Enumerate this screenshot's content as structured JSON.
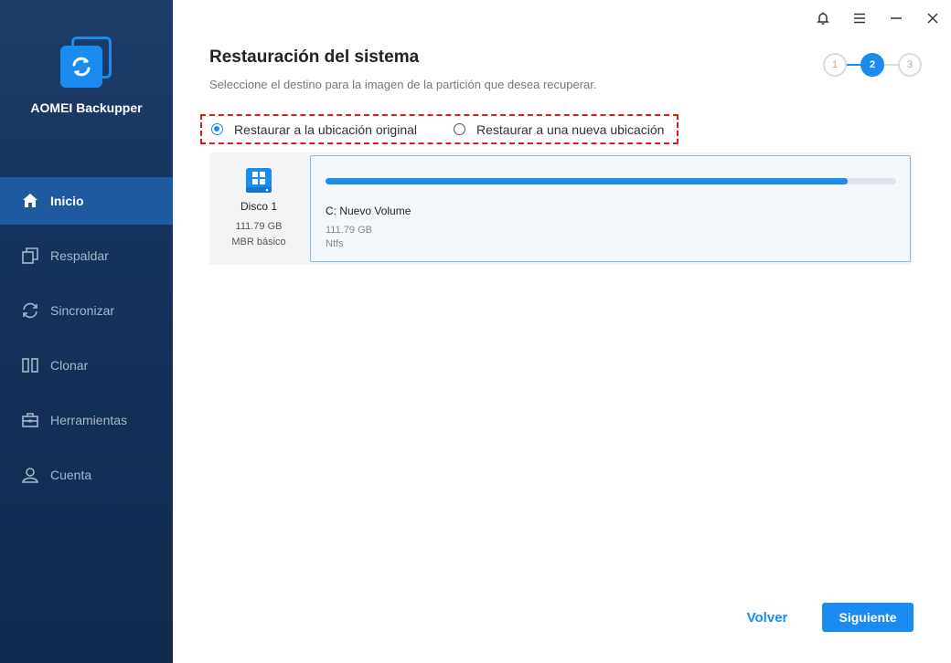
{
  "app": {
    "name": "AOMEI Backupper"
  },
  "window_controls": {
    "notifications_icon": "bell-icon",
    "menu_icon": "hamburger-icon",
    "minimize_icon": "minimize-icon",
    "close_icon": "close-icon"
  },
  "sidebar": {
    "items": [
      {
        "label": "Inicio",
        "icon": "home-icon",
        "active": true
      },
      {
        "label": "Respaldar",
        "icon": "backup-icon",
        "active": false
      },
      {
        "label": "Sincronizar",
        "icon": "sync-icon",
        "active": false
      },
      {
        "label": "Clonar",
        "icon": "clone-icon",
        "active": false
      },
      {
        "label": "Herramientas",
        "icon": "toolbox-icon",
        "active": false
      },
      {
        "label": "Cuenta",
        "icon": "user-icon",
        "active": false
      }
    ]
  },
  "page": {
    "title": "Restauración del sistema",
    "subtitle": "Seleccione el destino para la imagen de la partición que desea recuperar."
  },
  "steps": {
    "items": [
      "1",
      "2",
      "3"
    ],
    "current": 2
  },
  "restore_options": {
    "original": {
      "label": "Restaurar a la ubicación original",
      "checked": true
    },
    "new": {
      "label": "Restaurar a una nueva ubicación",
      "checked": false
    }
  },
  "disk": {
    "name": "Disco 1",
    "size": "111.79 GB",
    "type": "MBR básico",
    "icon": "windows-disk-icon"
  },
  "partition": {
    "name": "C: Nuevo Volume",
    "size": "111.79 GB",
    "filesystem": "Ntfs",
    "used_fraction": 0.915
  },
  "buttons": {
    "back": "Volver",
    "next": "Siguiente"
  },
  "colors": {
    "accent": "#1a8cf0",
    "sidebar": "#16315a",
    "highlight_border": "#e0191f"
  }
}
